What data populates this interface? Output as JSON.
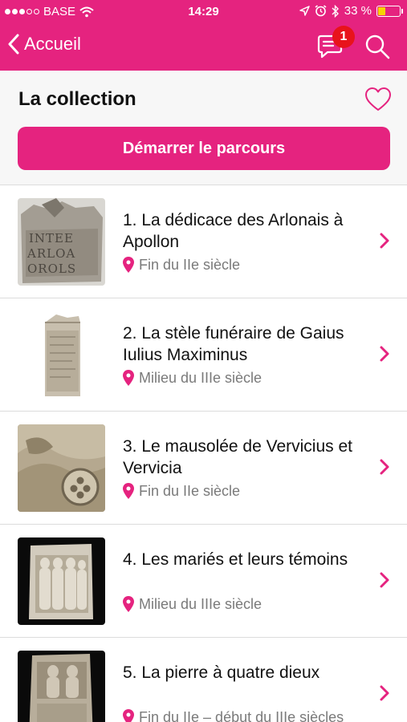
{
  "status_bar": {
    "carrier": "BASE",
    "time": "14:29",
    "battery": "33 %",
    "battery_level": 0.33
  },
  "nav": {
    "back_label": "Accueil",
    "notification_count": "1"
  },
  "header": {
    "title": "La collection",
    "start_button": "Démarrer le parcours"
  },
  "items": [
    {
      "title": "1. La dédicace des Arlonais à Apollon",
      "period": "Fin du IIe siècle",
      "thumb_icon": "stone-inscription-thumbnail"
    },
    {
      "title": "2. La stèle funéraire de Gaius Iulius Maximinus",
      "period": "Milieu du IIIe siècle",
      "thumb_icon": "stele-thumbnail"
    },
    {
      "title": "3. Le mausolée de Vervicius et Vervicia",
      "period": "Fin du IIe siècle",
      "thumb_icon": "relief-wheel-thumbnail"
    },
    {
      "title": "4. Les mariés et leurs témoins",
      "period": "Milieu du IIIe siècle",
      "thumb_icon": "figures-relief-thumbnail"
    },
    {
      "title": "5. La pierre à quatre dieux",
      "period": "Fin du IIe – début du IIIe siècles",
      "thumb_icon": "four-gods-stone-thumbnail"
    }
  ],
  "colors": {
    "accent": "#e5237f",
    "badge": "#e8131b",
    "meta_text": "#7a7a7a"
  }
}
